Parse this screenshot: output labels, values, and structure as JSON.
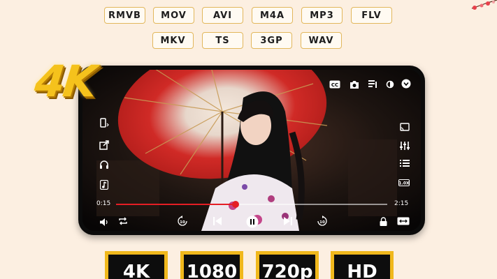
{
  "formats_row1": [
    "RMVB",
    "MOV",
    "AVI",
    "M4A",
    "MP3",
    "FLV"
  ],
  "formats_row2": [
    "MKV",
    "TS",
    "3GP",
    "WAV"
  ],
  "logo": {
    "text": "4K"
  },
  "player": {
    "time_elapsed": "0:15",
    "time_total": "2:15",
    "progress": 0.44,
    "top_icons": [
      "cc-icon",
      "camera-icon",
      "playlist-icon",
      "brightness-icon",
      "dropdown-icon"
    ],
    "left_icons": [
      "rotate-icon",
      "popup-icon",
      "headphones-icon",
      "music-icon"
    ],
    "right_icons": [
      "cast-icon",
      "equalizer-icon",
      "queue-icon",
      "speed-icon"
    ],
    "accent_color": "#e41e24"
  },
  "resolutions": [
    "4K",
    "1080",
    "720p",
    "HD"
  ]
}
